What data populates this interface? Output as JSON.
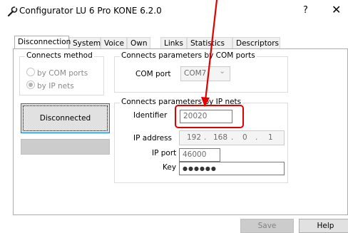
{
  "window": {
    "title": "Configurator LU 6 Pro KONE 6.2.0",
    "help_glyph": "?",
    "close_glyph": "✕"
  },
  "tabs": [
    "Disconnection",
    "System",
    "Voice",
    "Own",
    "Links",
    "Statistics",
    "Descriptors"
  ],
  "active_tab": "Disconnection",
  "connects_method": {
    "label": "Connects method",
    "options": [
      "by COM ports",
      "by IP nets"
    ],
    "selected": "by IP nets"
  },
  "com": {
    "label": "Connects parameters by COM ports",
    "port_label": "COM port",
    "port_value": "COM7",
    "chevron": "⌄"
  },
  "ip": {
    "label": "Connects parameters by IP nets",
    "identifier_label": "Identifier",
    "identifier_value": "20020",
    "address_label": "IP address",
    "address_octets": [
      "192",
      "168",
      "0",
      "1"
    ],
    "dot": ".",
    "port_label": "IP port",
    "port_value": "46000",
    "key_label": "Key",
    "key_value": "●●●●●●"
  },
  "status_button": "Disconnected",
  "footer": {
    "save": "Save",
    "help": "Help"
  },
  "colors": {
    "annotation": "#e00000",
    "focus_border": "#0078d7"
  }
}
